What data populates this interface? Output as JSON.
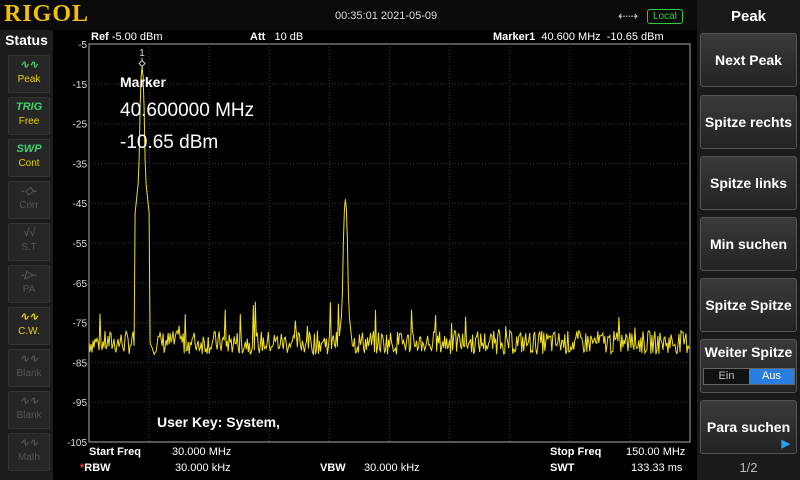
{
  "header": {
    "logo": "RIGOL",
    "datetime": "00:35:01  2021-05-09",
    "remote_badge": "Local",
    "usb_icon": "usb-icon"
  },
  "status": {
    "title": "Status",
    "tiles": [
      {
        "icon": "peak-wave-icon",
        "label": "Peak",
        "active": true
      },
      {
        "icon": "TRIG",
        "label": "Free",
        "active": true
      },
      {
        "icon": "SWP",
        "label": "Cont",
        "active": true
      },
      {
        "icon": "corr-icon",
        "label": "Corr",
        "active": false
      },
      {
        "icon": "st-icon",
        "label": "S.T",
        "active": false
      },
      {
        "icon": "pa-icon",
        "label": "PA",
        "active": false
      },
      {
        "icon": "cw-wave-icon",
        "label": "C.W.",
        "active": true
      },
      {
        "icon": "blank-wave-icon",
        "label": "Blank",
        "active": false
      },
      {
        "icon": "blank-wave-icon",
        "label": "Blank",
        "active": false
      },
      {
        "icon": "math-wave-icon",
        "label": "Math",
        "active": false
      }
    ]
  },
  "plot_header": {
    "ref_label": "Ref",
    "ref_value": "-5.00 dBm",
    "att_label": "Att",
    "att_value": "10 dB",
    "marker_label": "Marker1",
    "marker_freq": "40.600 MHz",
    "marker_amp": "-10.65 dBm"
  },
  "marker_box": {
    "title": "Marker",
    "freq": "40.600000 MHz",
    "amp": "-10.65 dBm",
    "marker_number": "1"
  },
  "user_key": "User Key:   System,",
  "bottom": {
    "start_label": "Start Freq",
    "start_value": "30.000 MHz",
    "stop_label": "Stop Freq",
    "stop_value": "150.00 MHz",
    "rbw_label": "RBW",
    "rbw_value": "30.000 kHz",
    "vbw_label": "VBW",
    "vbw_value": "30.000 kHz",
    "swt_label": "SWT",
    "swt_value": "133.33 ms",
    "rbw_star": "*"
  },
  "chart_data": {
    "type": "line",
    "xlim": [
      30.0,
      150.0
    ],
    "ylim": [
      -105,
      -5
    ],
    "yticks": [
      "-5",
      "-15",
      "-25",
      "-35",
      "-45",
      "-55",
      "-65",
      "-75",
      "-85",
      "-95",
      "-105"
    ],
    "grid": true,
    "noise_floor": -80,
    "peaks": [
      {
        "x": 40.6,
        "y": -10.65
      },
      {
        "x": 81.2,
        "y": -44.0
      }
    ],
    "trace_color": "#f0e020"
  },
  "menu": {
    "title": "Peak",
    "buttons": [
      "Next Peak",
      "Spitze rechts",
      "Spitze links",
      "Min suchen",
      "Spitze Spitze"
    ],
    "continuous_label": "Weiter Spitze",
    "continuous_options": [
      "Ein",
      "Aus"
    ],
    "continuous_selected": "Aus",
    "search_label": "Para suchen",
    "page": "1/2"
  }
}
